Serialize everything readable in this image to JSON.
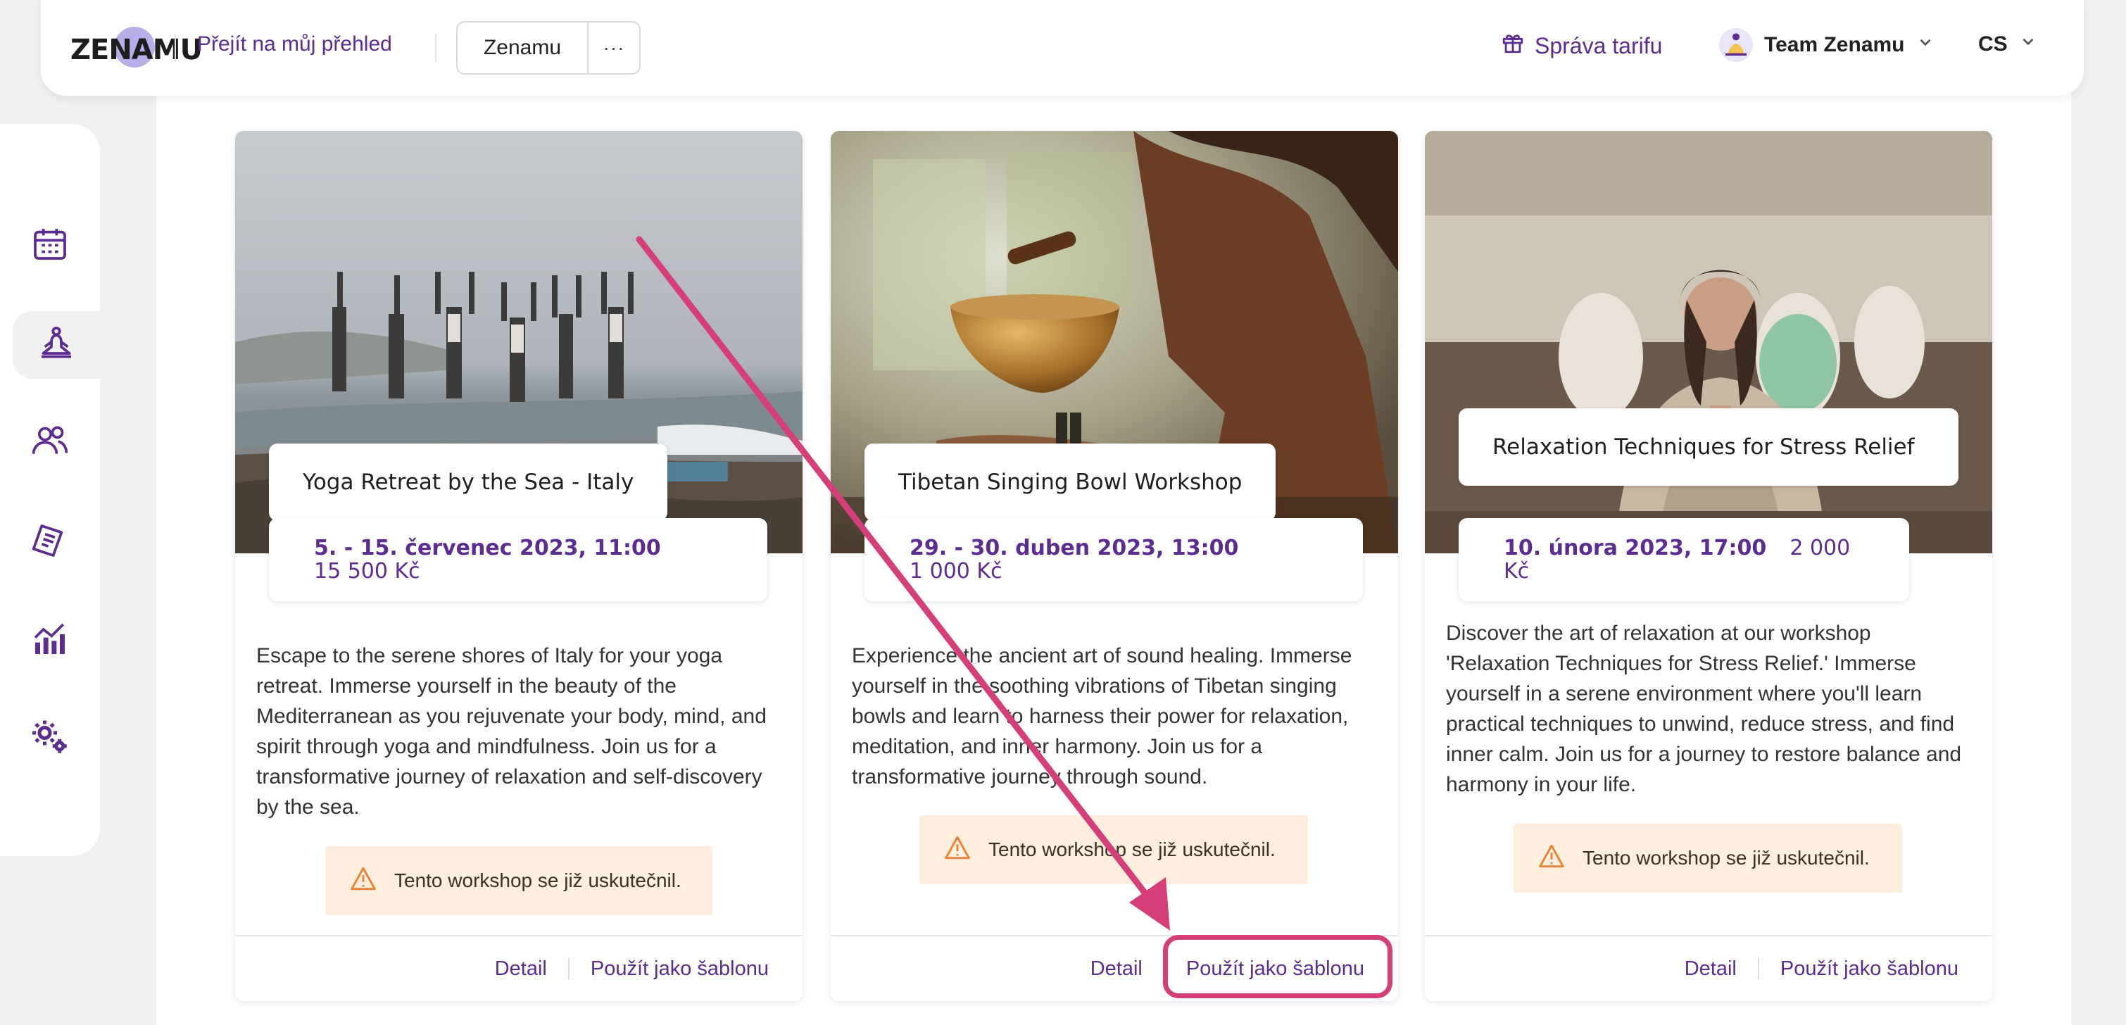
{
  "header": {
    "logo_text": "ZENAMU",
    "nav_link": "Přejít na můj přehled",
    "workspace_button": "Zenamu",
    "more_button": "···",
    "plan_link": "Správa tarifu",
    "team_name": "Team Zenamu",
    "language": "CS"
  },
  "sidebar": {
    "items": [
      {
        "name": "calendar-icon",
        "active": false
      },
      {
        "name": "meditation-icon",
        "active": true
      },
      {
        "name": "people-icon",
        "active": false
      },
      {
        "name": "notes-icon",
        "active": false
      },
      {
        "name": "analytics-icon",
        "active": false
      },
      {
        "name": "settings-icon",
        "active": false
      }
    ]
  },
  "cards": [
    {
      "title": "Yoga Retreat by the Sea - Italy",
      "date": "5. - 15. červenec 2023, 11:00",
      "price": "15 500 Kč",
      "description": "Escape to the serene shores of Italy for your yoga retreat. Immerse yourself in the beauty of the Mediterranean as you rejuvenate your body, mind, and spirit through yoga and mindfulness. Join us for a transformative journey of relaxation and self-discovery by the sea.",
      "warning": "Tento workshop se již uskutečnil.",
      "detail_link": "Detail",
      "template_link": "Použít jako šablonu"
    },
    {
      "title": "Tibetan Singing Bowl Workshop",
      "date": "29. - 30. duben 2023, 13:00",
      "price": "1 000 Kč",
      "description": "Experience the ancient art of sound healing. Immerse yourself in the soothing vibrations of Tibetan singing bowls and learn to harness their power for relaxation, meditation, and inner harmony. Join us for a transformative journey through sound.",
      "warning": "Tento workshop se již uskutečnil.",
      "detail_link": "Detail",
      "template_link": "Použít jako šablonu"
    },
    {
      "title": "Relaxation Techniques for Stress Relief",
      "date": "10. února 2023, 17:00",
      "price": "2 000 Kč",
      "description": "Discover the art of relaxation at our workshop 'Relaxation Techniques for Stress Relief.' Immerse yourself in a serene environment where you'll learn practical techniques to unwind, reduce stress, and find inner calm. Join us for a journey to restore balance and harmony in your life.",
      "warning": "Tento workshop se již uskutečnil.",
      "detail_link": "Detail",
      "template_link": "Použít jako šablonu"
    }
  ],
  "colors": {
    "brand": "#5b2d91",
    "annotation": "#d43f7a",
    "warning_bg": "#fdeedd",
    "warning_icon": "#e8833a"
  }
}
